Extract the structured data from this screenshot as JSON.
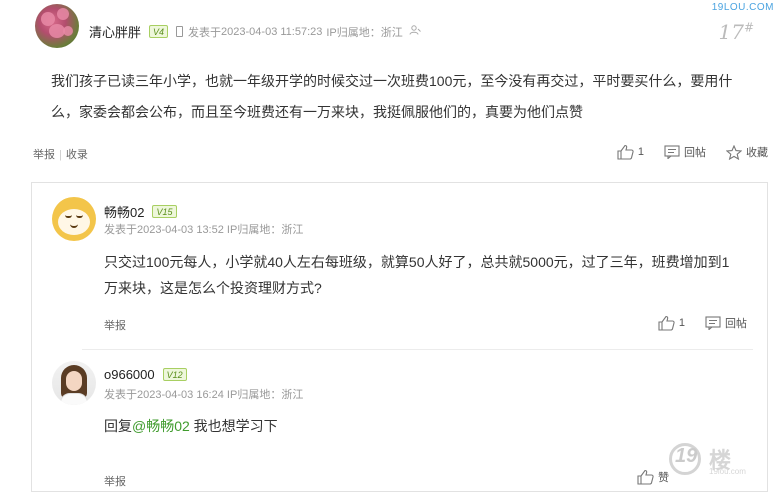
{
  "site": {
    "watermark": "19LOU.COM"
  },
  "main_post": {
    "username": "清心胖胖",
    "level": "4",
    "meta_prefix": "发表于",
    "timestamp": "2023-04-03 11:57:23",
    "location_label": "IP归属地：浙江",
    "floor": "17",
    "floor_suffix": "#",
    "body": "我们孩子已读三年小学，也就一年级开学的时候交过一次班费100元，至今没有再交过，平时要买什么，要用什么，家委会都会公布，而且至今班费还有一万来块，我挺佩服他们的，真要为他们点赞",
    "report_label": "举报",
    "favorite_label": "收录",
    "like_count": "1",
    "reply_label": "回帖",
    "collect_label": "收藏"
  },
  "replies": [
    {
      "username": "畅畅02",
      "level": "15",
      "meta_prefix": "发表于",
      "timestamp": "2023-04-03 13:52",
      "location_label": "IP归属地：浙江",
      "body": "只交过100元每人，小学就40人左右每班级，就算50人好了，总共就5000元，过了三年，班费增加到1万来块，这是怎么个投资理财方式?",
      "report_label": "举报",
      "like_count": "1",
      "reply_label": "回帖"
    },
    {
      "username": "o966000",
      "level": "12",
      "meta_prefix": "发表于",
      "timestamp": "2023-04-03 16:24",
      "location_label": "IP归属地：浙江",
      "body_prefix": "回复",
      "mention": "@畅畅02",
      "body_suffix": " 我也想学习下",
      "report_label": "举报",
      "like_label": "赞"
    }
  ],
  "logo": {
    "number": "19",
    "text": "楼",
    "sub": "19lou.com"
  }
}
